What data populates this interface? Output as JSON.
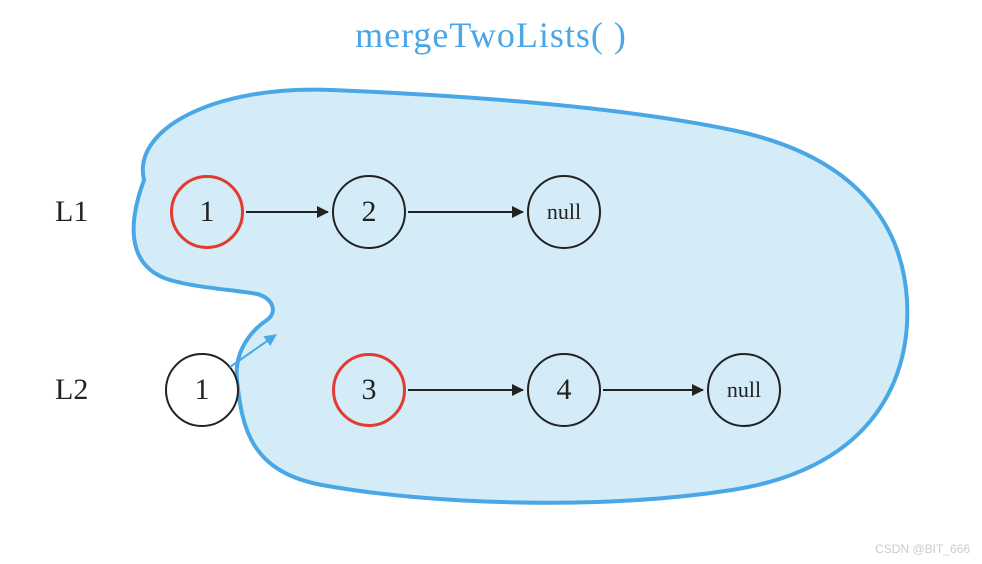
{
  "title": "mergeTwoLists( )",
  "labels": {
    "l1": "L1",
    "l2": "L2"
  },
  "l1": {
    "n1": "1",
    "n2": "2",
    "n3": "null"
  },
  "l2": {
    "n1": "1",
    "n2": "3",
    "n3": "4",
    "n4": "null"
  },
  "watermark": "CSDN @BIT_666",
  "diagram": {
    "description": "Recursive mergeTwoLists: L2 head (1) is chosen, arrow from it points into blob containing recursive call mergeTwoLists(L1=[1,2,null], L2.next=[3,4,null]). Red-circled nodes are current heads inside recursion.",
    "highlighted_nodes": [
      "L1.n1",
      "L2.n2"
    ],
    "outside_blob": [
      "L2.n1"
    ]
  }
}
